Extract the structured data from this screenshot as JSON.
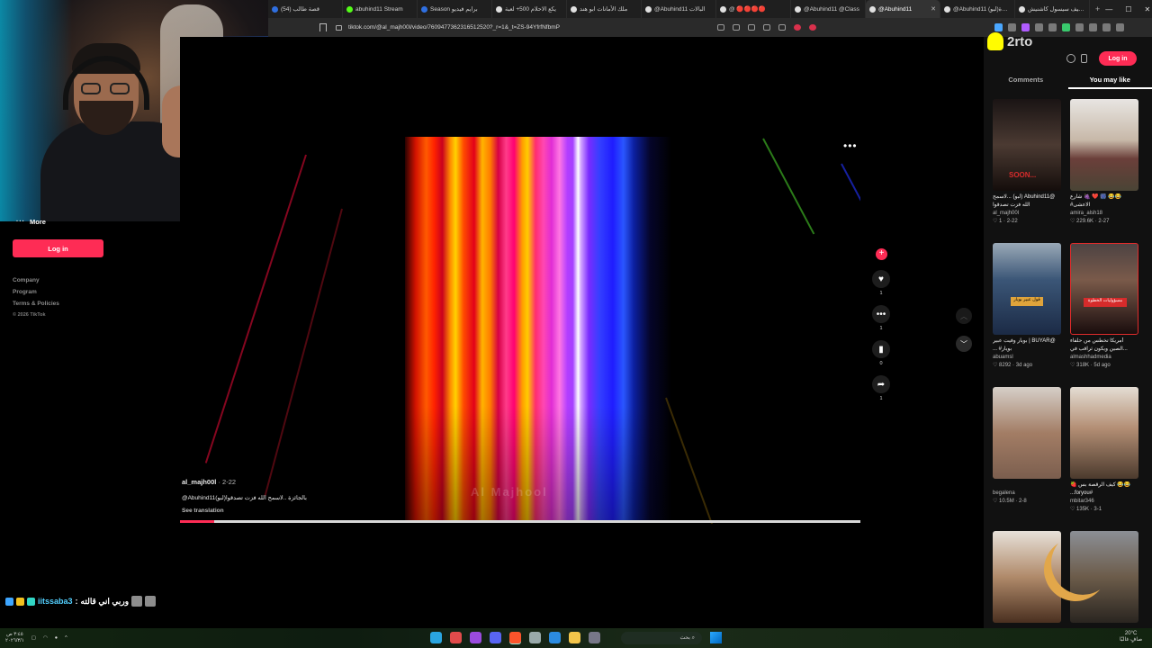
{
  "browser": {
    "tabs": [
      {
        "title": "(54) قصة طالب",
        "icon": "youtube"
      },
      {
        "title": "abuhind11 Stream",
        "icon": "kick"
      },
      {
        "title": "Season برايم فيديو",
        "icon": "prime"
      },
      {
        "title": "يكع الاحلام 500+ لعبة",
        "icon": "tiktok"
      },
      {
        "title": "ملك الأمانات ابو هند",
        "icon": "tiktok"
      },
      {
        "title": "@Abuhind11 البالات",
        "icon": "tiktok"
      },
      {
        "title": "@ 🔴🔴🔴🔴",
        "icon": "tiktok"
      },
      {
        "title": "@Abuhind11 @Class",
        "icon": "tiktok"
      },
      {
        "title": "@Abuhind11",
        "icon": "tiktok",
        "active": true,
        "close": "✕"
      },
      {
        "title": "@Abuhind11 (لبو)بالجائزة",
        "icon": "tiktok"
      },
      {
        "title": "ارشيف سيسول كاشنيش",
        "icon": "tiktok"
      }
    ],
    "new_tab": "+",
    "window_controls": [
      "—",
      "☐",
      "✕"
    ],
    "url": "tiktok.com/@al_majh00l/video/7609477362316512520?_r=1&_t=ZS-94YfrfNfbmP"
  },
  "overlay": {
    "snap_name": "2rto",
    "chat": {
      "username": "iitssaba3",
      "separator": ":",
      "message": "وربي اني قالته"
    }
  },
  "sidebar": {
    "more_label": "More",
    "login_label": "Log in",
    "footer": [
      "Company",
      "Program",
      "Terms & Policies"
    ],
    "copyright": "© 2026 TikTok"
  },
  "video": {
    "author": "al_majh00l",
    "date": " · 2-22",
    "caption": "@Abuhind11(لبو)بالجائزة ..لاسمح الله فزت تصدقوا",
    "see_translation": "See translation",
    "watermark": "Al Majhool",
    "more_icon": "•••",
    "progress": 0.05,
    "actions": [
      {
        "name": "like",
        "icon": "♥",
        "count": "1"
      },
      {
        "name": "comment",
        "icon": "💬",
        "count": "1"
      },
      {
        "name": "save",
        "icon": "🔖",
        "count": "0"
      },
      {
        "name": "share",
        "icon": "➦",
        "count": "1"
      }
    ],
    "follow_icon": "+",
    "nav_up": "︿",
    "nav_down": "﹀"
  },
  "right_panel": {
    "login_label": "Log in",
    "tabs": [
      {
        "label": "Comments",
        "active": false
      },
      {
        "label": "You may like",
        "active": true
      }
    ],
    "cards": [
      {
        "title": "@Abuhind11 (لبو) ...لاسمح الله فزت تصدقوا",
        "user": "al_majh00l",
        "stats": "♡ 1 · 2-22",
        "thumb_text": "SOON..."
      },
      {
        "title": "😂😂 🎆 ❤️ 🍇 شارع الاعشى#",
        "user": "amira_alsh18",
        "stats": "♡ 229.6K · 2-27"
      },
      {
        "title": "@BUYAR | بويار وفيت عبير بويار# ...",
        "user": "abuamsl",
        "stats": "♡ 8292 · 3d ago",
        "thumb_text": "قول عبير بويار"
      },
      {
        "title": "أمريكا تخطس من حلفاء ...الصين ويكون ثراقب في",
        "user": "almashhadmedia",
        "stats": "♡ 318K · 5d ago",
        "thumb_text": "مسؤوليات الخطوة"
      },
      {
        "title": "",
        "user": "begalena",
        "stats": "♡ 10.5M · 2-8"
      },
      {
        "title": "😂😂 كيف الرقصة بس 🍓 #foryou...",
        "user": "mbitar346",
        "stats": "♡ 135K · 3-1"
      },
      {
        "title": "",
        "user": "",
        "stats": ""
      },
      {
        "title": "",
        "user": "",
        "stats": ""
      }
    ]
  },
  "taskbar": {
    "clock_time": "٣:٤٥ ص",
    "clock_date": "٢٠٢٦/٣/١",
    "search_label": "بحث",
    "weather": "20°C",
    "weather_label": "صافٍ غالبًا"
  }
}
